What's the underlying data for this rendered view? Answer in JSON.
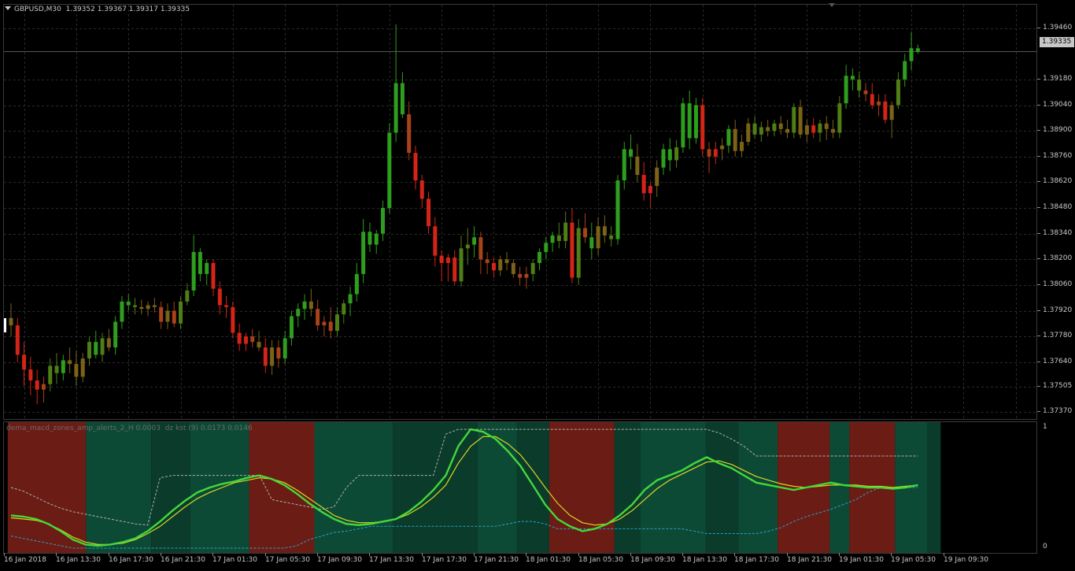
{
  "window": {
    "symbol_label": "GBPUSD,M30",
    "ohlc_label": "1.39352 1.39367 1.39317 1.39335",
    "current_price": "1.39335"
  },
  "indicator": {
    "title": "dema_macd_zones_amp_alerts_2_H 0.0003  dz kst (9) 0.0173 0.0146",
    "scale_labels": [
      "1",
      "0"
    ]
  },
  "price_axis": {
    "ticks": [
      "1.39460",
      "1.39180",
      "1.39040",
      "1.38900",
      "1.38760",
      "1.38620",
      "1.38480",
      "1.38340",
      "1.38200",
      "1.38060",
      "1.37920",
      "1.37780",
      "1.37640",
      "1.37505",
      "1.37370"
    ]
  },
  "time_axis": {
    "ticks": [
      "16 Jan 2018",
      "16 Jan 13:30",
      "16 Jan 17:30",
      "16 Jan 21:30",
      "17 Jan 01:30",
      "17 Jan 05:30",
      "17 Jan 09:30",
      "17 Jan 13:30",
      "17 Jan 17:30",
      "17 Jan 21:30",
      "18 Jan 01:30",
      "18 Jan 05:30",
      "18 Jan 09:30",
      "18 Jan 13:30",
      "18 Jan 17:30",
      "18 Jan 21:30",
      "19 Jan 01:30",
      "19 Jan 05:30",
      "19 Jan 09:30"
    ]
  },
  "colors": {
    "background": "#000000",
    "grid": "#2a2a2a",
    "bull_strong": "#2e9e1e",
    "bull_mid": "#4f7d16",
    "neutral": "#7a6318",
    "bear_mid": "#a8421a",
    "bear_strong": "#d42418",
    "zone_red": "#6b1c15",
    "zone_green_dark": "#0a3b2b",
    "zone_green": "#0d4a36",
    "main_line": "#44d83a",
    "signal_line": "#d8d820",
    "upper_band": "#b0b0b0",
    "lower_band": "#2aa0c8"
  },
  "chart_data": {
    "type": "candlestick",
    "x_start": "16 Jan 2018 08:30",
    "x_step_minutes": 30,
    "ylim": [
      1.3733,
      1.3951
    ],
    "ohlc": [
      [
        1.3788,
        1.3796,
        1.3778,
        1.3784
      ],
      [
        1.3784,
        1.3788,
        1.3764,
        1.3768
      ],
      [
        1.3768,
        1.3775,
        1.3751,
        1.376
      ],
      [
        1.376,
        1.3767,
        1.3746,
        1.3754
      ],
      [
        1.3754,
        1.376,
        1.3741,
        1.3749
      ],
      [
        1.3749,
        1.3756,
        1.3742,
        1.3752
      ],
      [
        1.3752,
        1.3766,
        1.3748,
        1.3762
      ],
      [
        1.3762,
        1.3769,
        1.3752,
        1.3758
      ],
      [
        1.3758,
        1.3768,
        1.3754,
        1.3765
      ],
      [
        1.3765,
        1.3772,
        1.3758,
        1.3763
      ],
      [
        1.3763,
        1.377,
        1.3751,
        1.3756
      ],
      [
        1.3756,
        1.3769,
        1.3753,
        1.3766
      ],
      [
        1.3766,
        1.3778,
        1.3762,
        1.3775
      ],
      [
        1.3775,
        1.3781,
        1.3766,
        1.3768
      ],
      [
        1.3768,
        1.378,
        1.3764,
        1.3777
      ],
      [
        1.3777,
        1.3782,
        1.377,
        1.3772
      ],
      [
        1.3772,
        1.3789,
        1.3768,
        1.3786
      ],
      [
        1.3786,
        1.38,
        1.3782,
        1.3797
      ],
      [
        1.3797,
        1.3801,
        1.3792,
        1.3795
      ],
      [
        1.3795,
        1.3799,
        1.379,
        1.3794
      ],
      [
        1.3794,
        1.3798,
        1.379,
        1.3793
      ],
      [
        1.3793,
        1.3797,
        1.3789,
        1.3795
      ],
      [
        1.3795,
        1.3799,
        1.3791,
        1.3794
      ],
      [
        1.3794,
        1.3797,
        1.3782,
        1.3786
      ],
      [
        1.3786,
        1.3796,
        1.3782,
        1.3792
      ],
      [
        1.3792,
        1.3797,
        1.3783,
        1.3785
      ],
      [
        1.3785,
        1.38,
        1.3782,
        1.3797
      ],
      [
        1.3797,
        1.3807,
        1.3795,
        1.3803
      ],
      [
        1.3803,
        1.3833,
        1.38,
        1.3824
      ],
      [
        1.3824,
        1.3826,
        1.3808,
        1.3812
      ],
      [
        1.3812,
        1.382,
        1.3806,
        1.3818
      ],
      [
        1.3818,
        1.382,
        1.38,
        1.3804
      ],
      [
        1.3804,
        1.3808,
        1.379,
        1.3795
      ],
      [
        1.3795,
        1.38,
        1.3788,
        1.3794
      ],
      [
        1.3794,
        1.3797,
        1.3777,
        1.378
      ],
      [
        1.378,
        1.3785,
        1.377,
        1.3774
      ],
      [
        1.3774,
        1.378,
        1.377,
        1.3778
      ],
      [
        1.3778,
        1.3782,
        1.3772,
        1.3775
      ],
      [
        1.3775,
        1.3781,
        1.377,
        1.3772
      ],
      [
        1.3772,
        1.3777,
        1.3758,
        1.3762
      ],
      [
        1.3762,
        1.3776,
        1.3757,
        1.3772
      ],
      [
        1.3772,
        1.3776,
        1.3761,
        1.3766
      ],
      [
        1.3766,
        1.3781,
        1.3763,
        1.3777
      ],
      [
        1.3777,
        1.3792,
        1.3773,
        1.3789
      ],
      [
        1.3789,
        1.3796,
        1.3783,
        1.3793
      ],
      [
        1.3793,
        1.3801,
        1.3787,
        1.3797
      ],
      [
        1.3797,
        1.3804,
        1.3789,
        1.3793
      ],
      [
        1.3793,
        1.3798,
        1.3781,
        1.3784
      ],
      [
        1.3784,
        1.3789,
        1.3778,
        1.3786
      ],
      [
        1.3786,
        1.3794,
        1.3777,
        1.3781
      ],
      [
        1.3781,
        1.3794,
        1.3778,
        1.379
      ],
      [
        1.379,
        1.3798,
        1.3785,
        1.3796
      ],
      [
        1.3796,
        1.3805,
        1.3789,
        1.3801
      ],
      [
        1.3801,
        1.3818,
        1.3797,
        1.3812
      ],
      [
        1.3812,
        1.3842,
        1.3807,
        1.3835
      ],
      [
        1.3835,
        1.384,
        1.3824,
        1.3828
      ],
      [
        1.3828,
        1.3836,
        1.3823,
        1.3834
      ],
      [
        1.3834,
        1.3852,
        1.383,
        1.3848
      ],
      [
        1.3848,
        1.3894,
        1.3845,
        1.3889
      ],
      [
        1.3889,
        1.3948,
        1.3884,
        1.3916
      ],
      [
        1.3916,
        1.3922,
        1.3897,
        1.3899
      ],
      [
        1.3899,
        1.3906,
        1.3874,
        1.3878
      ],
      [
        1.3878,
        1.3882,
        1.3858,
        1.3863
      ],
      [
        1.3863,
        1.3866,
        1.3848,
        1.3853
      ],
      [
        1.3853,
        1.3857,
        1.3834,
        1.3838
      ],
      [
        1.3838,
        1.3843,
        1.3816,
        1.3822
      ],
      [
        1.3822,
        1.3825,
        1.3808,
        1.3818
      ],
      [
        1.3818,
        1.3823,
        1.3808,
        1.3821
      ],
      [
        1.3821,
        1.3825,
        1.3806,
        1.3808
      ],
      [
        1.3808,
        1.3833,
        1.3805,
        1.3826
      ],
      [
        1.3826,
        1.3837,
        1.3817,
        1.3828
      ],
      [
        1.3828,
        1.3838,
        1.3821,
        1.3832
      ],
      [
        1.3832,
        1.3835,
        1.3812,
        1.382
      ],
      [
        1.382,
        1.3824,
        1.3812,
        1.3818
      ],
      [
        1.3818,
        1.3821,
        1.381,
        1.3814
      ],
      [
        1.3814,
        1.3822,
        1.3811,
        1.382
      ],
      [
        1.382,
        1.3824,
        1.3814,
        1.3818
      ],
      [
        1.3818,
        1.382,
        1.381,
        1.3812
      ],
      [
        1.3812,
        1.3816,
        1.3806,
        1.381
      ],
      [
        1.381,
        1.3816,
        1.3804,
        1.3812
      ],
      [
        1.3812,
        1.382,
        1.3808,
        1.3818
      ],
      [
        1.3818,
        1.3826,
        1.3814,
        1.3824
      ],
      [
        1.3824,
        1.3832,
        1.382,
        1.3829
      ],
      [
        1.3829,
        1.3835,
        1.3824,
        1.3833
      ],
      [
        1.3833,
        1.384,
        1.3826,
        1.383
      ],
      [
        1.383,
        1.3846,
        1.3826,
        1.384
      ],
      [
        1.384,
        1.3848,
        1.3807,
        1.381
      ],
      [
        1.381,
        1.3842,
        1.3806,
        1.3837
      ],
      [
        1.3837,
        1.3845,
        1.3829,
        1.3832
      ],
      [
        1.3832,
        1.384,
        1.382,
        1.3826
      ],
      [
        1.3826,
        1.3843,
        1.3822,
        1.3838
      ],
      [
        1.3838,
        1.3844,
        1.3829,
        1.3833
      ],
      [
        1.3833,
        1.3838,
        1.3827,
        1.3831
      ],
      [
        1.3831,
        1.3866,
        1.3828,
        1.3863
      ],
      [
        1.3863,
        1.3884,
        1.3858,
        1.388
      ],
      [
        1.388,
        1.3888,
        1.3869,
        1.3876
      ],
      [
        1.3876,
        1.3883,
        1.3862,
        1.3866
      ],
      [
        1.3866,
        1.3873,
        1.3852,
        1.3856
      ],
      [
        1.3856,
        1.3862,
        1.3848,
        1.386
      ],
      [
        1.386,
        1.3874,
        1.3854,
        1.387
      ],
      [
        1.387,
        1.3883,
        1.3866,
        1.388
      ],
      [
        1.388,
        1.3886,
        1.3868,
        1.3874
      ],
      [
        1.3874,
        1.3885,
        1.387,
        1.3881
      ],
      [
        1.3881,
        1.3908,
        1.3878,
        1.3905
      ],
      [
        1.3905,
        1.3912,
        1.388,
        1.3886
      ],
      [
        1.3886,
        1.3908,
        1.3883,
        1.3904
      ],
      [
        1.3904,
        1.3908,
        1.3876,
        1.388
      ],
      [
        1.388,
        1.3884,
        1.3867,
        1.3876
      ],
      [
        1.3876,
        1.3884,
        1.3872,
        1.388
      ],
      [
        1.388,
        1.3886,
        1.3874,
        1.3882
      ],
      [
        1.3882,
        1.3893,
        1.3878,
        1.3891
      ],
      [
        1.3891,
        1.3896,
        1.3876,
        1.3879
      ],
      [
        1.3879,
        1.3888,
        1.3876,
        1.3884
      ],
      [
        1.3884,
        1.3897,
        1.3882,
        1.3894
      ],
      [
        1.3894,
        1.3898,
        1.3886,
        1.3888
      ],
      [
        1.3888,
        1.3895,
        1.3884,
        1.3892
      ],
      [
        1.3892,
        1.3896,
        1.3887,
        1.389
      ],
      [
        1.389,
        1.3896,
        1.3887,
        1.3894
      ],
      [
        1.3894,
        1.3898,
        1.3888,
        1.3891
      ],
      [
        1.3891,
        1.3896,
        1.3886,
        1.3889
      ],
      [
        1.3889,
        1.3905,
        1.3886,
        1.3903
      ],
      [
        1.3903,
        1.3907,
        1.3886,
        1.3888
      ],
      [
        1.3888,
        1.3896,
        1.3884,
        1.3893
      ],
      [
        1.3893,
        1.3897,
        1.3886,
        1.3889
      ],
      [
        1.3889,
        1.3896,
        1.3884,
        1.3894
      ],
      [
        1.3894,
        1.3898,
        1.3885,
        1.3891
      ],
      [
        1.3891,
        1.3896,
        1.3886,
        1.3889
      ],
      [
        1.3889,
        1.3909,
        1.3886,
        1.3905
      ],
      [
        1.3905,
        1.3926,
        1.3902,
        1.392
      ],
      [
        1.392,
        1.3924,
        1.3912,
        1.3918
      ],
      [
        1.3918,
        1.3922,
        1.3908,
        1.3912
      ],
      [
        1.3912,
        1.3916,
        1.3906,
        1.391
      ],
      [
        1.391,
        1.3916,
        1.3902,
        1.3904
      ],
      [
        1.3904,
        1.391,
        1.3898,
        1.3906
      ],
      [
        1.3906,
        1.391,
        1.3894,
        1.3896
      ],
      [
        1.3896,
        1.3906,
        1.3886,
        1.3904
      ],
      [
        1.3904,
        1.3922,
        1.3902,
        1.3918
      ],
      [
        1.3918,
        1.3932,
        1.3914,
        1.3928
      ],
      [
        1.3928,
        1.3944,
        1.3923,
        1.3935
      ],
      [
        1.3935,
        1.3937,
        1.3932,
        1.3933
      ]
    ],
    "indicator_zones": [
      {
        "from": 0,
        "to": 11,
        "zone": "red"
      },
      {
        "from": 12,
        "to": 21,
        "zone": "green"
      },
      {
        "from": 22,
        "to": 27,
        "zone": "green-dark"
      },
      {
        "from": 28,
        "to": 36,
        "zone": "green"
      },
      {
        "from": 37,
        "to": 46,
        "zone": "red"
      },
      {
        "from": 47,
        "to": 58,
        "zone": "green"
      },
      {
        "from": 59,
        "to": 71,
        "zone": "green-dark"
      },
      {
        "from": 72,
        "to": 77,
        "zone": "green"
      },
      {
        "from": 78,
        "to": 82,
        "zone": "green-dark"
      },
      {
        "from": 83,
        "to": 92,
        "zone": "red"
      },
      {
        "from": 93,
        "to": 96,
        "zone": "green-dark"
      },
      {
        "from": 97,
        "to": 106,
        "zone": "green"
      },
      {
        "from": 107,
        "to": 111,
        "zone": "green-dark"
      },
      {
        "from": 112,
        "to": 117,
        "zone": "green"
      },
      {
        "from": 118,
        "to": 125,
        "zone": "red"
      },
      {
        "from": 126,
        "to": 128,
        "zone": "green"
      },
      {
        "from": 129,
        "to": 135,
        "zone": "red"
      },
      {
        "from": 136,
        "to": 140,
        "zone": "green"
      },
      {
        "from": 141,
        "to": 142,
        "zone": "green-dark"
      }
    ],
    "indicator_main": [
      0.27,
      0.26,
      0.24,
      0.2,
      0.14,
      0.07,
      0.03,
      0.02,
      0.03,
      0.05,
      0.08,
      0.14,
      0.22,
      0.31,
      0.39,
      0.46,
      0.5,
      0.53,
      0.55,
      0.58,
      0.6,
      0.57,
      0.52,
      0.45,
      0.37,
      0.3,
      0.24,
      0.2,
      0.19,
      0.2,
      0.22,
      0.24,
      0.3,
      0.38,
      0.48,
      0.6,
      0.84,
      0.98,
      0.96,
      0.9,
      0.8,
      0.68,
      0.52,
      0.36,
      0.24,
      0.18,
      0.14,
      0.16,
      0.2,
      0.27,
      0.36,
      0.48,
      0.56,
      0.6,
      0.64,
      0.7,
      0.75,
      0.7,
      0.66,
      0.6,
      0.54,
      0.52,
      0.5,
      0.48,
      0.5,
      0.52,
      0.54,
      0.52,
      0.51,
      0.5,
      0.5,
      0.49,
      0.5,
      0.52
    ],
    "indicator_signal": [
      0.25,
      0.24,
      0.23,
      0.2,
      0.15,
      0.09,
      0.05,
      0.03,
      0.03,
      0.04,
      0.07,
      0.12,
      0.18,
      0.26,
      0.34,
      0.41,
      0.46,
      0.5,
      0.54,
      0.56,
      0.58,
      0.57,
      0.54,
      0.48,
      0.41,
      0.34,
      0.27,
      0.23,
      0.21,
      0.21,
      0.22,
      0.24,
      0.28,
      0.34,
      0.42,
      0.52,
      0.7,
      0.84,
      0.92,
      0.92,
      0.86,
      0.77,
      0.64,
      0.5,
      0.37,
      0.27,
      0.21,
      0.19,
      0.2,
      0.24,
      0.31,
      0.4,
      0.49,
      0.56,
      0.61,
      0.66,
      0.71,
      0.72,
      0.69,
      0.64,
      0.59,
      0.56,
      0.53,
      0.51,
      0.5,
      0.51,
      0.52,
      0.52,
      0.52,
      0.51,
      0.51,
      0.5,
      0.51,
      0.52
    ],
    "indicator_upper": [
      0.5,
      0.47,
      0.42,
      0.37,
      0.33,
      0.3,
      0.28,
      0.26,
      0.24,
      0.22,
      0.2,
      0.19,
      0.58,
      0.6,
      0.6,
      0.6,
      0.6,
      0.6,
      0.6,
      0.6,
      0.6,
      0.4,
      0.38,
      0.36,
      0.34,
      0.32,
      0.34,
      0.5,
      0.6,
      0.6,
      0.6,
      0.6,
      0.6,
      0.6,
      0.6,
      0.94,
      0.98,
      0.98,
      0.98,
      0.98,
      0.98,
      0.98,
      0.98,
      0.98,
      0.98,
      0.98,
      0.98,
      0.98,
      0.98,
      0.98,
      0.98,
      0.98,
      0.98,
      0.98,
      0.98,
      0.98,
      0.98,
      0.95,
      0.9,
      0.84,
      0.76,
      0.76,
      0.76,
      0.76,
      0.76,
      0.76,
      0.76,
      0.76,
      0.76,
      0.76,
      0.76,
      0.76,
      0.76,
      0.76
    ],
    "indicator_lower": [
      0.1,
      0.08,
      0.06,
      0.04,
      0.02,
      0.0,
      0.0,
      0.0,
      0.0,
      0.0,
      0.0,
      0.0,
      0.0,
      0.0,
      0.0,
      0.0,
      0.0,
      0.0,
      0.0,
      0.0,
      0.0,
      0.0,
      0.0,
      0.02,
      0.07,
      0.1,
      0.13,
      0.14,
      0.16,
      0.18,
      0.18,
      0.18,
      0.18,
      0.18,
      0.18,
      0.18,
      0.18,
      0.18,
      0.18,
      0.18,
      0.2,
      0.22,
      0.22,
      0.2,
      0.16,
      0.16,
      0.16,
      0.16,
      0.16,
      0.16,
      0.16,
      0.16,
      0.16,
      0.16,
      0.16,
      0.14,
      0.12,
      0.12,
      0.12,
      0.12,
      0.12,
      0.14,
      0.17,
      0.22,
      0.26,
      0.29,
      0.32,
      0.36,
      0.4,
      0.46,
      0.5,
      0.5,
      0.5,
      0.5
    ]
  }
}
